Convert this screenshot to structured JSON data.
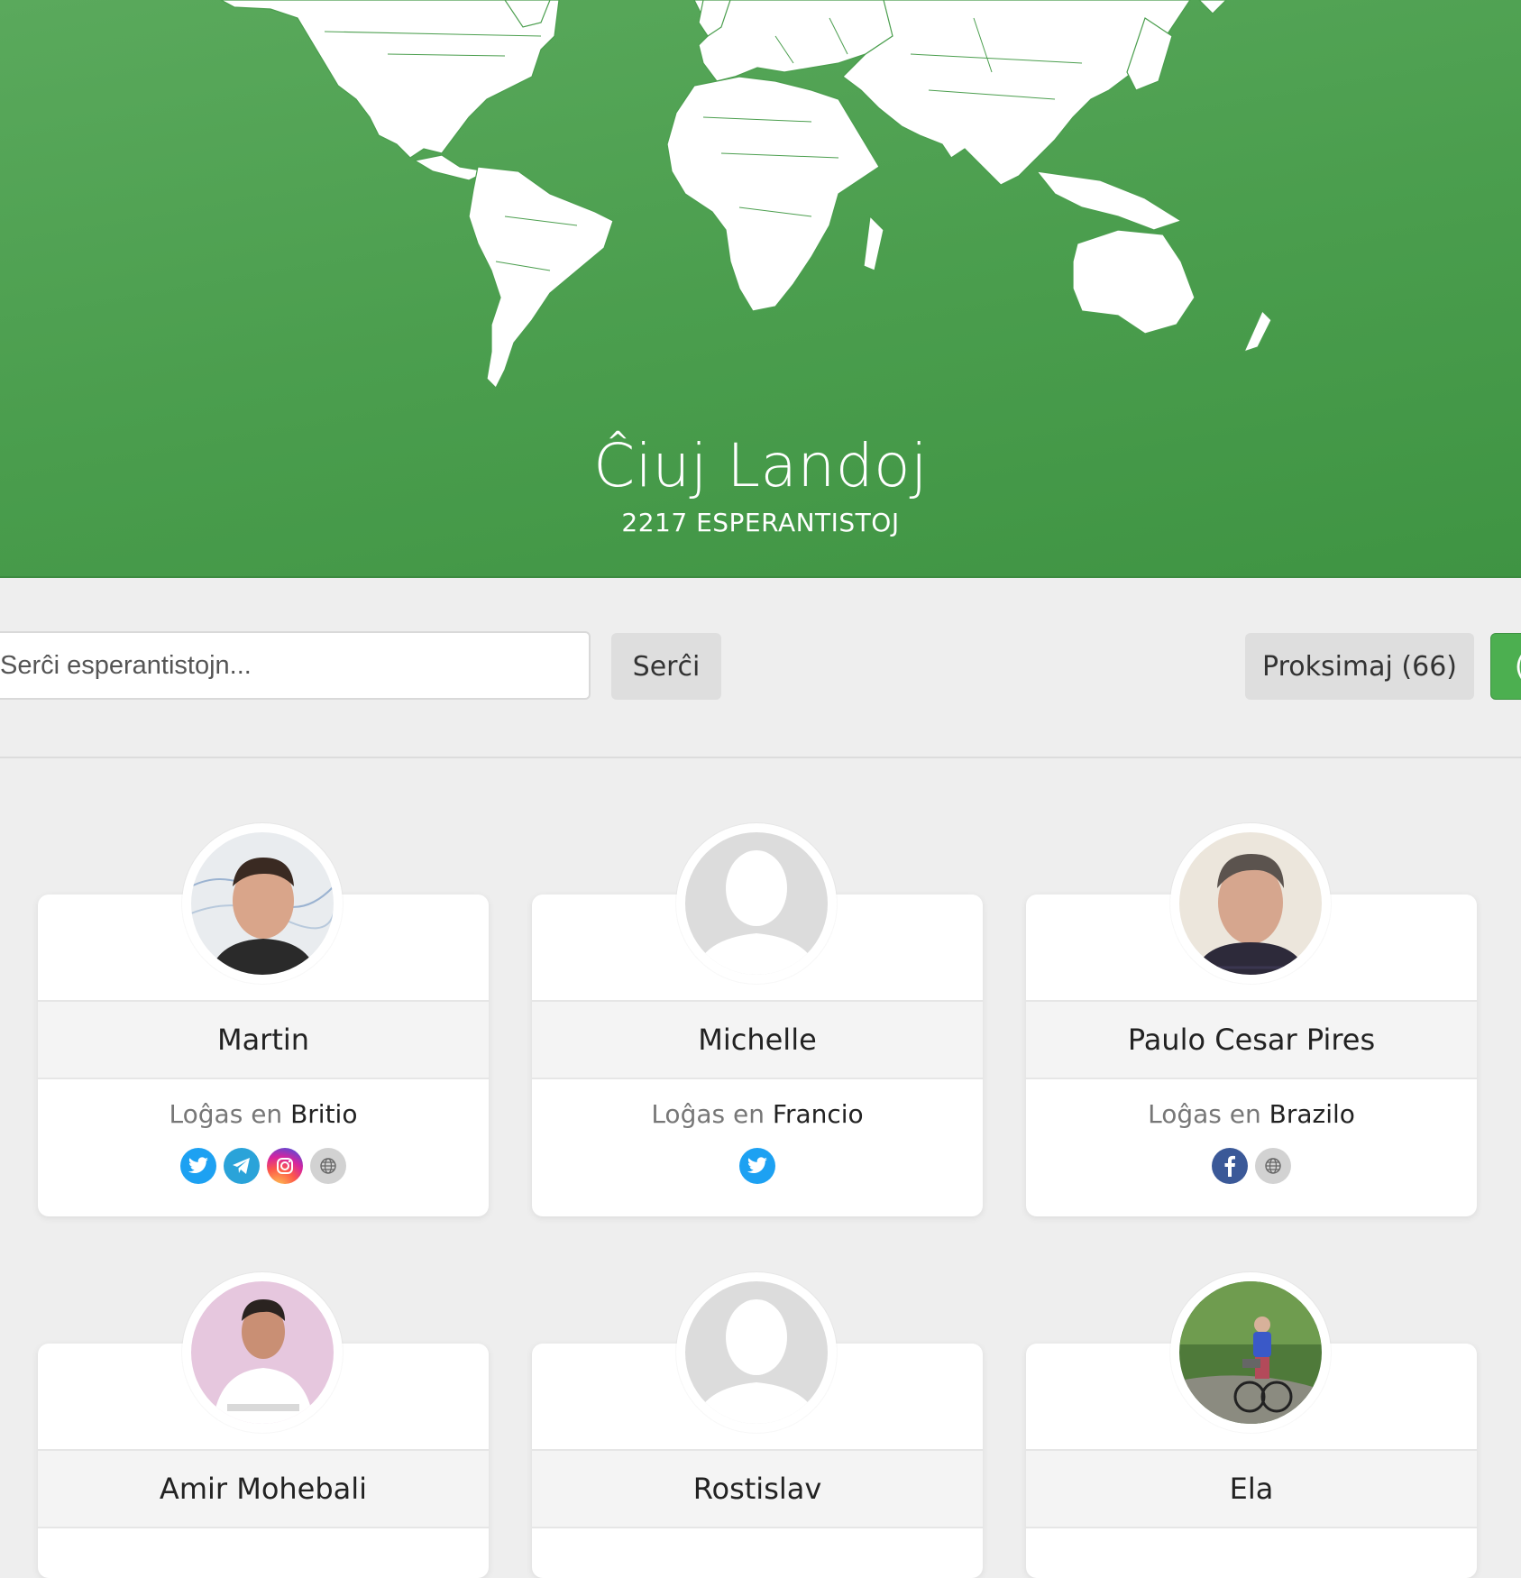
{
  "header": {
    "title": "Ĉiuj Landoj",
    "subtitle": "2217 ESPERANTISTOJ"
  },
  "toolbar": {
    "search_placeholder": "Serĉi esperantistojn...",
    "search_button": "Serĉi",
    "nearby_button": "Proksimaj (66)",
    "green_button_partial": "("
  },
  "location_prefix": "Loĝas en",
  "cards": [
    {
      "name": "Martin",
      "country": "Britio",
      "avatar": "photo",
      "socials": [
        "twitter-icon",
        "telegram-icon",
        "instagram-icon",
        "website-icon"
      ]
    },
    {
      "name": "Michelle",
      "country": "Francio",
      "avatar": "placeholder",
      "socials": [
        "twitter-icon"
      ]
    },
    {
      "name": "Paulo Cesar Pires",
      "country": "Brazilo",
      "avatar": "photo",
      "socials": [
        "facebook-icon",
        "website-icon"
      ]
    },
    {
      "name": "Amir Mohebali",
      "avatar": "photo"
    },
    {
      "name": "Rostislav",
      "avatar": "placeholder"
    },
    {
      "name": "Ela",
      "avatar": "photo"
    }
  ],
  "colors": {
    "header_green": "#4b9e4e",
    "accent_green": "#4caf50",
    "page_bg": "#eeeeee",
    "twitter": "#1da1f2",
    "telegram": "#2aa3d9",
    "facebook": "#3b5998"
  }
}
